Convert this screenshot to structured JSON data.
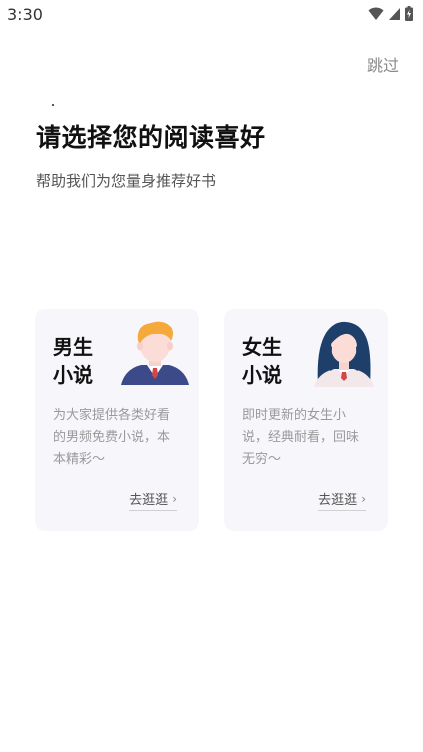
{
  "status": {
    "time": "3:30",
    "icons": [
      "wifi-icon",
      "signal-icon",
      "battery-charging-icon"
    ]
  },
  "header": {
    "skip_label": "跳过"
  },
  "main": {
    "title": "请选择您的阅读喜好",
    "subtitle": "帮助我们为您量身推荐好书"
  },
  "cards": {
    "male": {
      "title_line1": "男生",
      "title_line2": "小说",
      "description": "为大家提供各类好看的男频免费小说，本本精彩～",
      "link": "去逛逛",
      "avatar_icon": "male-avatar-icon"
    },
    "female": {
      "title_line1": "女生",
      "title_line2": "小说",
      "description": "即时更新的女生小说，经典耐看，回味无穷～",
      "link": "去逛逛",
      "avatar_icon": "female-avatar-icon"
    }
  },
  "colors": {
    "card_bg": "#f6f6fb",
    "male_hair": "#f4a93a",
    "male_suit": "#3d4a8a",
    "tie": "#d64545",
    "female_hair": "#1f3f6b"
  }
}
